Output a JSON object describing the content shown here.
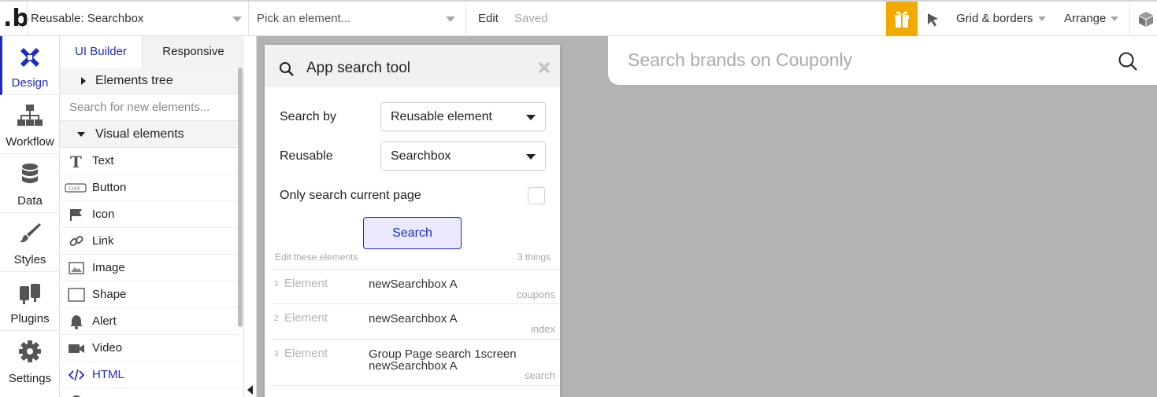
{
  "topbar": {
    "logo": ".b",
    "page_select": "Reusable: Searchbox",
    "element_picker_placeholder": "Pick an element...",
    "edit": "Edit",
    "status": "Saved",
    "grid_menu": "Grid & borders",
    "arrange_menu": "Arrange",
    "gift_color": "#f2a900"
  },
  "rail": {
    "accent": "#1d2ac6",
    "items": [
      {
        "label": "Design",
        "icon": "design-icon"
      },
      {
        "label": "Workflow",
        "icon": "workflow-icon"
      },
      {
        "label": "Data",
        "icon": "database-icon"
      },
      {
        "label": "Styles",
        "icon": "brush-icon"
      },
      {
        "label": "Plugins",
        "icon": "plug-icon"
      },
      {
        "label": "Settings",
        "icon": "gear-icon"
      }
    ]
  },
  "panel": {
    "tabs": [
      "UI Builder",
      "Responsive"
    ],
    "elements_tree": "Elements tree",
    "search_placeholder": "Search for new elements...",
    "visual_elements": "Visual elements",
    "elements": [
      "Text",
      "Button",
      "Icon",
      "Link",
      "Image",
      "Shape",
      "Alert",
      "Video",
      "HTML",
      "Map"
    ]
  },
  "search_tool": {
    "title": "App search tool",
    "search_by_label": "Search by",
    "search_by_value": "Reusable element",
    "reusable_label": "Reusable",
    "reusable_value": "Searchbox",
    "only_current_label": "Only search current page",
    "search_button": "Search",
    "results_header": "Edit these elements",
    "results_count": "3 things",
    "results": [
      {
        "num": "1",
        "type": "Element",
        "name": "newSearchbox A",
        "page": "coupons"
      },
      {
        "num": "2",
        "type": "Element",
        "name": "newSearchbox A",
        "page": "index"
      },
      {
        "num": "3",
        "type": "Element",
        "name": "Group Page search 1screen newSearchbox A",
        "page": "search"
      }
    ]
  },
  "canvas": {
    "searchbox_placeholder": "Search brands on Couponly"
  }
}
